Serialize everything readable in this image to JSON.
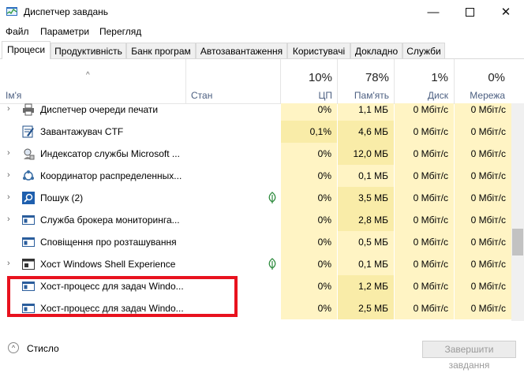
{
  "window": {
    "title": "Диспетчер завдань",
    "icon": "task-manager-icon",
    "controls": [
      "minimize-icon",
      "maximize-icon",
      "close-icon"
    ]
  },
  "menu": {
    "file": "Файл",
    "options": "Параметри",
    "view": "Перегляд"
  },
  "tabs": [
    "Процеси",
    "Продуктивність",
    "Банк програм",
    "Автозавантаження",
    "Користувачі",
    "Докладно",
    "Служби"
  ],
  "active_tab": "Процеси",
  "columns": {
    "name": "Ім'я",
    "status": "Стан",
    "cpu": {
      "pct": "10%",
      "label": "ЦП"
    },
    "memory": {
      "pct": "78%",
      "label": "Пам'ять"
    },
    "disk": {
      "pct": "1%",
      "label": "Диск"
    },
    "network": {
      "pct": "0%",
      "label": "Мережа"
    }
  },
  "rows": [
    {
      "expand": true,
      "icon": "printer-icon",
      "name": "Диспетчер очереди печати",
      "leaf": false,
      "cpu": "0%",
      "mem": "1,1 МБ",
      "disk": "0 Мбіт/с",
      "net": "0 Мбіт/с"
    },
    {
      "expand": false,
      "icon": "ctf-loader-icon",
      "name": "Завантажувач CTF",
      "leaf": false,
      "cpu": "0,1%",
      "mem": "4,6 МБ",
      "disk": "0 Мбіт/с",
      "net": "0 Мбіт/с"
    },
    {
      "expand": true,
      "icon": "search-indexer-icon",
      "name": "Индексатор службы Microsoft ...",
      "leaf": false,
      "cpu": "0%",
      "mem": "12,0 МБ",
      "disk": "0 Мбіт/с",
      "net": "0 Мбіт/с"
    },
    {
      "expand": true,
      "icon": "coordinator-icon",
      "name": "Координатор распределенных...",
      "leaf": false,
      "cpu": "0%",
      "mem": "0,1 МБ",
      "disk": "0 Мбіт/с",
      "net": "0 Мбіт/с"
    },
    {
      "expand": true,
      "icon": "search-icon",
      "name": "Пошук (2)",
      "leaf": true,
      "cpu": "0%",
      "mem": "3,5 МБ",
      "disk": "0 Мбіт/с",
      "net": "0 Мбіт/с"
    },
    {
      "expand": true,
      "icon": "window-service-icon",
      "name": "Служба брокера мониторинга...",
      "leaf": false,
      "cpu": "0%",
      "mem": "2,8 МБ",
      "disk": "0 Мбіт/с",
      "net": "0 Мбіт/с"
    },
    {
      "expand": false,
      "icon": "window-service-icon",
      "name": "Сповіщення про розташування",
      "leaf": false,
      "cpu": "0%",
      "mem": "0,5 МБ",
      "disk": "0 Мбіт/с",
      "net": "0 Мбіт/с"
    },
    {
      "expand": true,
      "icon": "shell-window-icon",
      "name": "Хост Windows Shell Experience",
      "leaf": true,
      "cpu": "0%",
      "mem": "0,1 МБ",
      "disk": "0 Мбіт/с",
      "net": "0 Мбіт/с"
    },
    {
      "expand": false,
      "icon": "window-service-icon",
      "name": "Хост-процесс для задач Windo...",
      "leaf": false,
      "cpu": "0%",
      "mem": "1,2 МБ",
      "disk": "0 Мбіт/с",
      "net": "0 Мбіт/с"
    },
    {
      "expand": false,
      "icon": "window-service-icon",
      "name": "Хост-процесс для задач Windo...",
      "leaf": false,
      "cpu": "0%",
      "mem": "2,5 МБ",
      "disk": "0 Мбіт/с",
      "net": "0 Мбіт/с"
    }
  ],
  "footer": {
    "less_details": "Стисло",
    "end_task": "Завершити завдання"
  },
  "colors": {
    "highlight": "#e8121e",
    "heat_light": "#fff4c4",
    "heat_mid": "#f9eca8"
  }
}
